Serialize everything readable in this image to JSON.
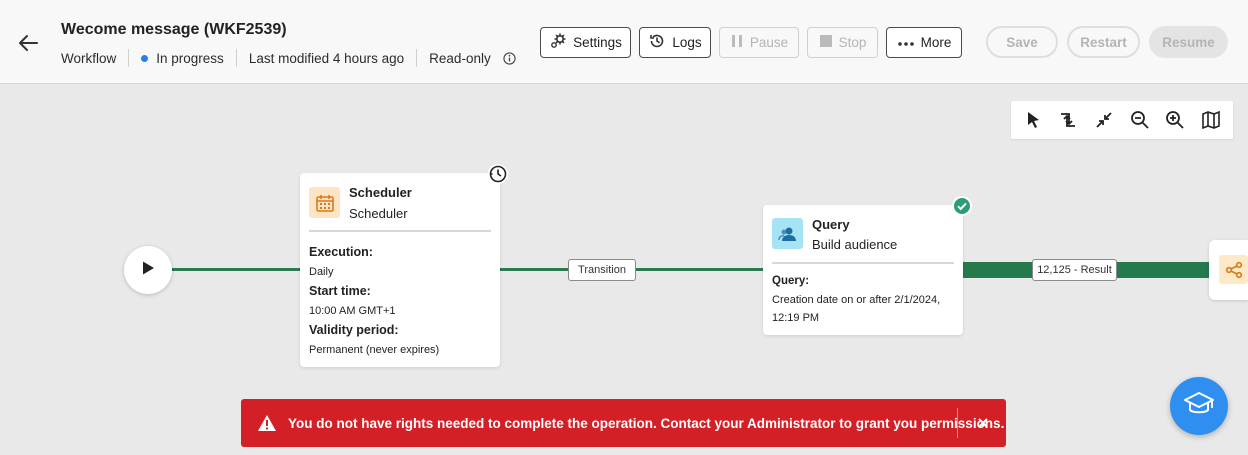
{
  "header": {
    "title": "Wecome message (WKF2539)",
    "meta": {
      "type": "Workflow",
      "status": "In progress",
      "modified": "Last modified 4 hours ago",
      "access": "Read-only"
    },
    "buttons": {
      "settings": "Settings",
      "logs": "Logs",
      "pause": "Pause",
      "stop": "Stop",
      "more": "More",
      "save": "Save",
      "restart": "Restart",
      "resume": "Resume"
    }
  },
  "canvas": {
    "scheduler": {
      "title": "Scheduler",
      "subtitle": "Scheduler",
      "execution_label": "Execution:",
      "execution_value": "Daily",
      "start_label": "Start time:",
      "start_value": "10:00 AM GMT+1",
      "validity_label": "Validity period:",
      "validity_value": "Permanent (never expires)"
    },
    "transition_label": "Transition",
    "query": {
      "title": "Query",
      "subtitle": "Build audience",
      "query_label": "Query:",
      "query_value_line1": "Creation date on or after 2/1/2024,",
      "query_value_line2": "12:19 PM"
    },
    "result_label": "12,125 - Result"
  },
  "toast": {
    "message": "You do not have rights needed to complete the operation. Contact your Administrator to grant you permissions."
  },
  "colors": {
    "accent": "#2680eb",
    "flow_line": "#2c7a50",
    "error": "#d31f26",
    "success": "#2d9d78",
    "help": "#2e8ff0"
  },
  "icons": [
    "back-arrow-icon",
    "info-icon",
    "gear-icon",
    "history-icon",
    "pause-icon",
    "stop-icon",
    "more-icon",
    "select-icon",
    "auto-layout-icon",
    "collapse-icon",
    "zoom-out-icon",
    "zoom-in-icon",
    "map-icon",
    "play-icon",
    "clock-icon",
    "calendar-icon",
    "users-icon",
    "check-icon",
    "share-icon",
    "warning-icon",
    "close-icon",
    "graduation-cap-icon"
  ]
}
